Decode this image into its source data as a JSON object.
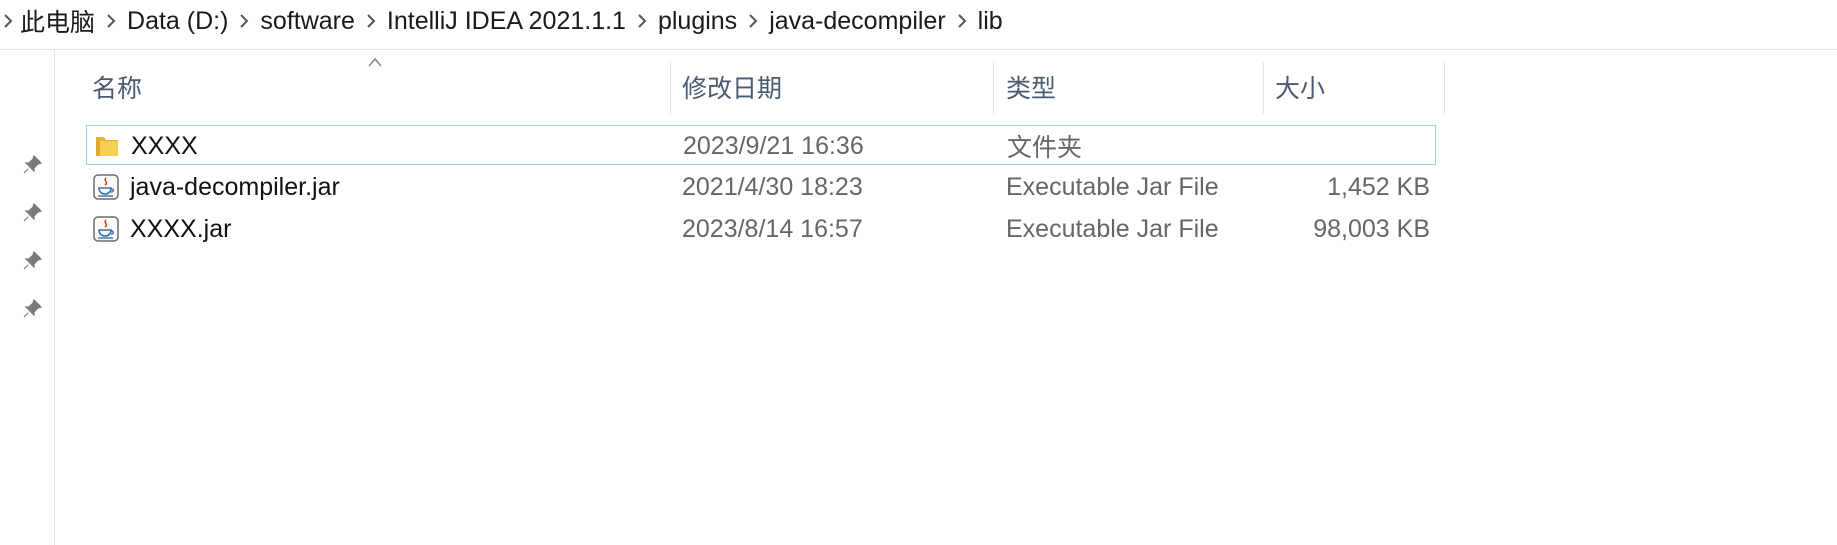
{
  "breadcrumb": [
    "此电脑",
    "Data (D:)",
    "software",
    "IntelliJ IDEA 2021.1.1",
    "plugins",
    "java-decompiler",
    "lib"
  ],
  "columns": {
    "name": "名称",
    "date": "修改日期",
    "type": "类型",
    "size": "大小"
  },
  "files": [
    {
      "name": "XXXX",
      "date": "2023/9/21 16:36",
      "type": "文件夹",
      "size": "",
      "icon": "folder-icon"
    },
    {
      "name": "java-decompiler.jar",
      "date": "2021/4/30 18:23",
      "type": "Executable Jar File",
      "size": "1,452 KB",
      "icon": "java-jar-icon"
    },
    {
      "name": "XXXX.jar",
      "date": "2023/8/14 16:57",
      "type": "Executable Jar File",
      "size": "98,003 KB",
      "icon": "java-jar-icon"
    }
  ],
  "quick_access_pins": [
    "pin-icon",
    "pin-icon",
    "pin-icon",
    "pin-icon"
  ],
  "colors": {
    "selection_border": "#99d1f3",
    "folder": "#f4c84a",
    "header_text": "#4a5a70"
  }
}
